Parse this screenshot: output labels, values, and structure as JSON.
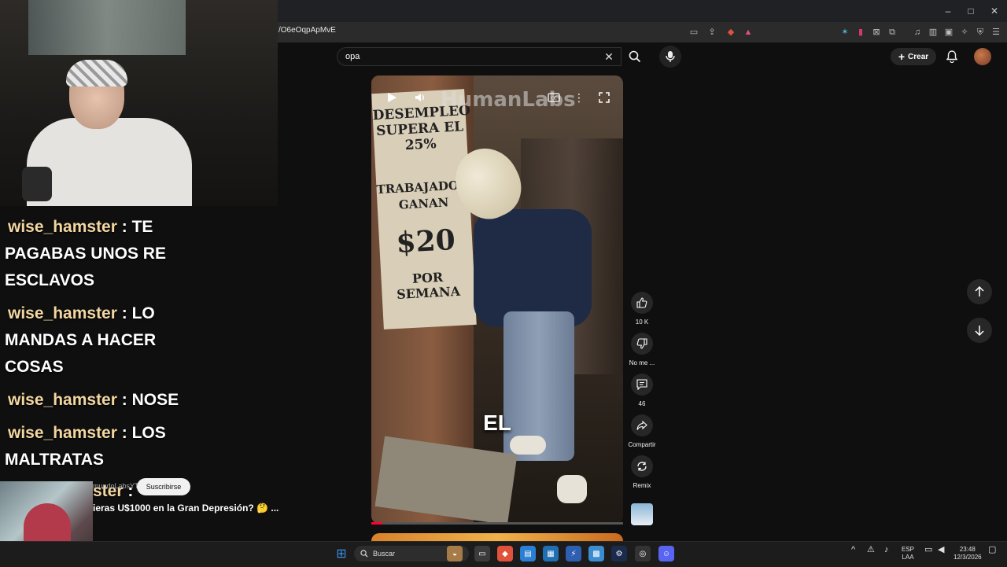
{
  "browser": {
    "url_fragment": "/O6eOqpApMvE",
    "window_controls": [
      "–",
      "□",
      "✕"
    ]
  },
  "youtube": {
    "search": {
      "query": "opa"
    },
    "header": {
      "create_label": "Crear"
    }
  },
  "short": {
    "watermark": "HumanLabs",
    "caption": "EL",
    "poster": {
      "line1": "DESEMPLEO SUPERA EL 25%",
      "line2": "TRABAJADORES GANAN",
      "line3": "$20",
      "line4": "POR SEMANA"
    },
    "actions": {
      "like_count": "10 K",
      "dislike_label": "No me ...",
      "comments_count": "46",
      "share_label": "Compartir",
      "remix_label": "Remix"
    },
    "overlay": {
      "channel_fragment": "mundoLabsYT",
      "subscribe_label": "Suscribirse",
      "title_fragment": "ieras U$1000 en la Gran Depresión? 🤔 ..."
    }
  },
  "chat": {
    "messages": [
      {
        "user": "wise_hamster",
        "text": " : TE PAGABAS UNOS RE ESCLAVOS"
      },
      {
        "user": "wise_hamster",
        "text": " : LO MANDAS A HACER COSAS"
      },
      {
        "user": "wise_hamster",
        "text": " : NOSE"
      },
      {
        "user": "wise_hamster",
        "text": " : LOS MALTRATAS"
      },
      {
        "user": "ster",
        "text": " :"
      }
    ]
  },
  "taskbar": {
    "search_label": "Buscar",
    "lang": "ESP",
    "lang_sub": "LAA",
    "time": "23:48",
    "date": "12/3/2026"
  }
}
